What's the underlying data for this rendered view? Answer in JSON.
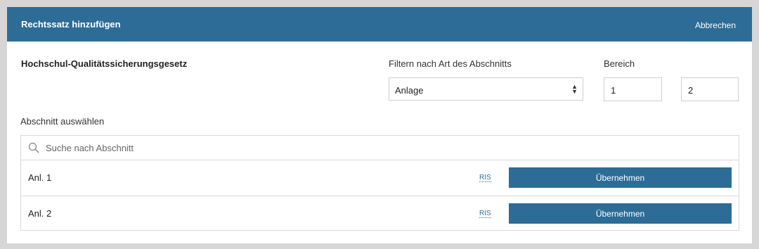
{
  "modal": {
    "title": "Rechtssatz hinzufügen",
    "cancel_label": "Abbrechen"
  },
  "law": {
    "title": "Hochschul-Qualitätssicherungsgesetz"
  },
  "filter": {
    "label": "Filtern nach Art des Abschnitts",
    "selected": "Anlage"
  },
  "range": {
    "label": "Bereich",
    "from": "1",
    "to": "2"
  },
  "section": {
    "label": "Abschnitt auswählen",
    "search_placeholder": "Suche nach Abschnitt",
    "items": [
      {
        "label": "Anl. 1",
        "link": "RIS",
        "button": "Übernehmen"
      },
      {
        "label": "Anl. 2",
        "link": "RIS",
        "button": "Übernehmen"
      }
    ]
  },
  "colors": {
    "accent": "#2d6c97",
    "backdrop": "#d6d6d6"
  }
}
